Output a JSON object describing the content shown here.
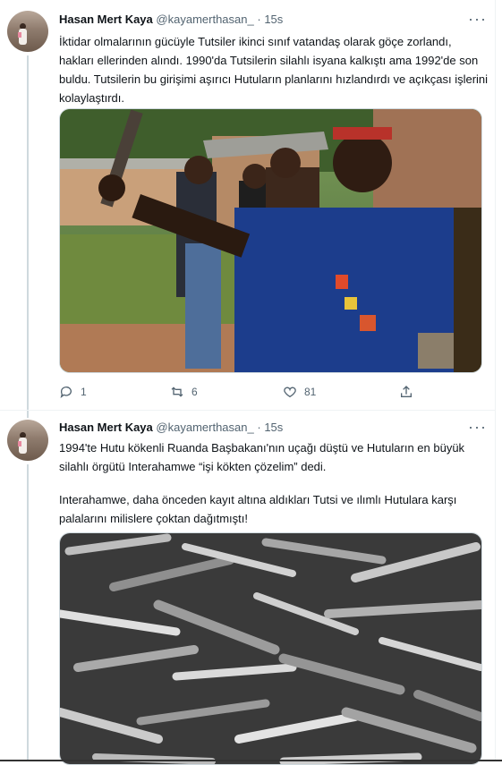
{
  "tweets": [
    {
      "author_name": "Hasan Mert Kaya",
      "handle": "@kayamerthasan_",
      "dot": "·",
      "time": "15s",
      "more_label": "···",
      "paragraphs": [
        "İktidar olmalarının gücüyle Tutsiler ikinci sınıf vatandaş olarak göçe zorlandı, hakları ellerinden alındı. 1990'da Tutsilerin silahlı isyana kalkıştı ama 1992'de son buldu. Tutsilerin bu girişimi aşırıcı Hutuların planlarını hızlandırdı ve açıkçası işlerini kolaylaştırdı."
      ],
      "media_icon": "armed-men-photo",
      "replies": "1",
      "retweets": "6",
      "likes": "81"
    },
    {
      "author_name": "Hasan Mert Kaya",
      "handle": "@kayamerthasan_",
      "dot": "·",
      "time": "15s",
      "more_label": "···",
      "paragraphs": [
        "1994'te Hutu kökenli Ruanda Başbakanı'nın uçağı düştü ve Hutuların en büyük silahlı örgütü Interahamwe “işi kökten çözelim” dedi.",
        "Interahamwe, daha önceden kayıt altına aldıkları Tutsi ve ılımlı Hutulara karşı palalarını milislere çoktan dağıtmıştı!"
      ],
      "media_icon": "machetes-pile-photo"
    }
  ],
  "colors": {
    "text": "#0f1419",
    "secondary": "#536471",
    "border": "#eff3f4",
    "thread": "#cfd9de"
  }
}
